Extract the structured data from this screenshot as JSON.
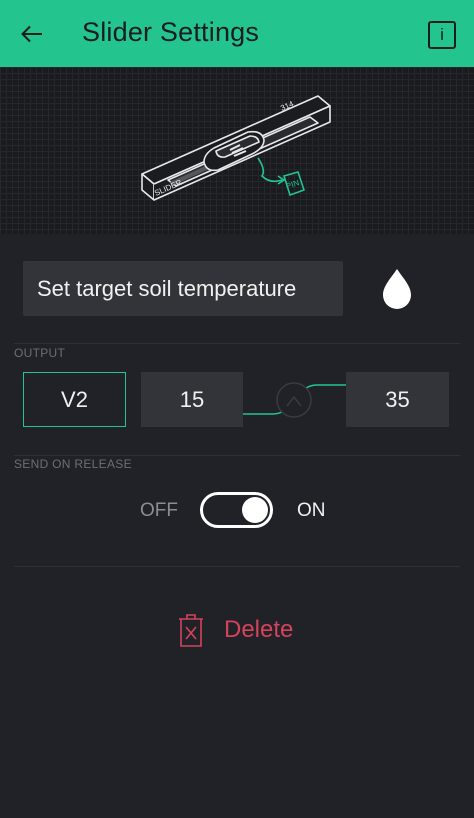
{
  "appbar": {
    "title": "Slider Settings",
    "back_icon": "arrow-back-icon",
    "info_icon": "info-icon",
    "info_glyph": "i",
    "color": "#23c48e"
  },
  "illustration": {
    "widget_label": "SLIDER",
    "value_label": "314",
    "pin_label": "PIN"
  },
  "name_field": {
    "value": "Set target soil temperature"
  },
  "color_picker": {
    "icon": "droplet-icon",
    "color": "#ffffff"
  },
  "output": {
    "section_label": "OUTPUT",
    "pin": "V2",
    "min": "15",
    "max": "35",
    "mapping_icon": "gauge-icon"
  },
  "send_on_release": {
    "section_label": "SEND ON RELEASE",
    "off_label": "OFF",
    "on_label": "ON",
    "enabled": true
  },
  "delete": {
    "label": "Delete",
    "icon": "trash-icon",
    "color": "#d3435c"
  }
}
